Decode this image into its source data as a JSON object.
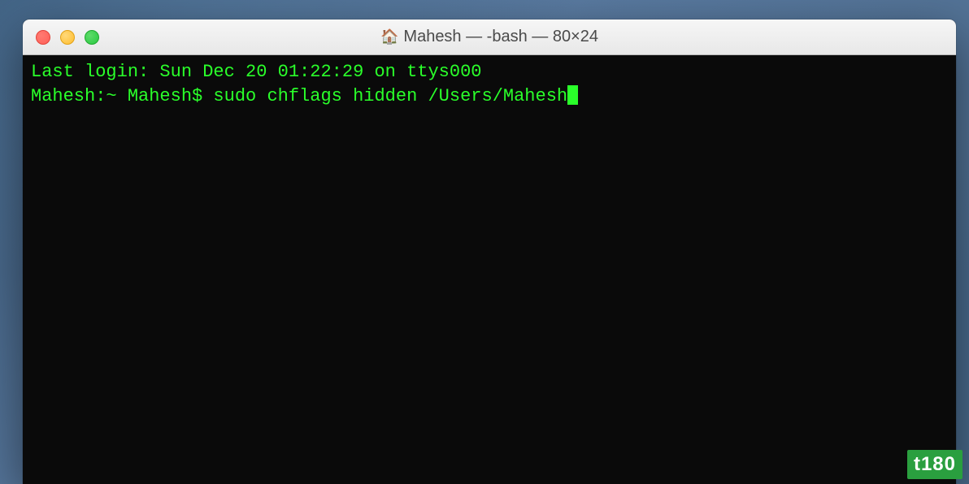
{
  "window": {
    "title": "Mahesh — -bash — 80×24",
    "icon_name": "home-icon",
    "icon_glyph": "🏠"
  },
  "terminal": {
    "text_color": "#2aff2a",
    "background_color": "#0a0a0a",
    "lines": [
      "Last login: Sun Dec 20 01:22:29 on ttys000",
      "Mahesh:~ Mahesh$ sudo chflags hidden /Users/Mahesh"
    ],
    "prompt": "Mahesh:~ Mahesh$ ",
    "command": "sudo chflags hidden /Users/Mahesh",
    "last_login": "Sun Dec 20 01:22:29 on ttys000"
  },
  "watermark": {
    "text": "t180"
  }
}
